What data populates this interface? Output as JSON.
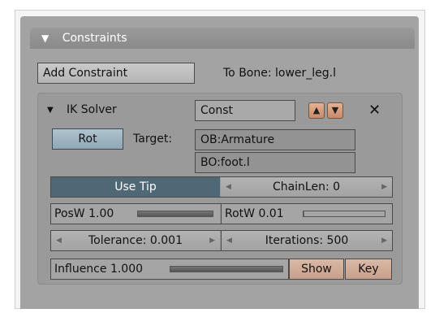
{
  "panel": {
    "title": "Constraints"
  },
  "add_constraint": {
    "label": "Add Constraint"
  },
  "to_bone": {
    "label": "To Bone: lower_leg.l"
  },
  "constraint": {
    "name": "IK Solver",
    "type_value": "Const",
    "rot_label": "Rot",
    "target_label": "Target:",
    "object_value": "OB:Armature",
    "bone_value": "BO:foot.l",
    "use_tip_label": "Use Tip",
    "chainlen_label": "ChainLen: 0",
    "posw_label": "PosW 1.00",
    "posw_value": 1.0,
    "rotw_label": "RotW 0.01",
    "rotw_value": 0.01,
    "tolerance_label": "Tolerance: 0.001",
    "iterations_label": "Iterations: 500",
    "influence_label": "Influence 1.000",
    "influence_value": 1.0,
    "show_label": "Show",
    "key_label": "Key"
  },
  "icons": {
    "collapse": "triangle-down-icon",
    "move_up": "chevron-up-icon",
    "move_down": "chevron-down-icon",
    "delete": "close-icon"
  }
}
